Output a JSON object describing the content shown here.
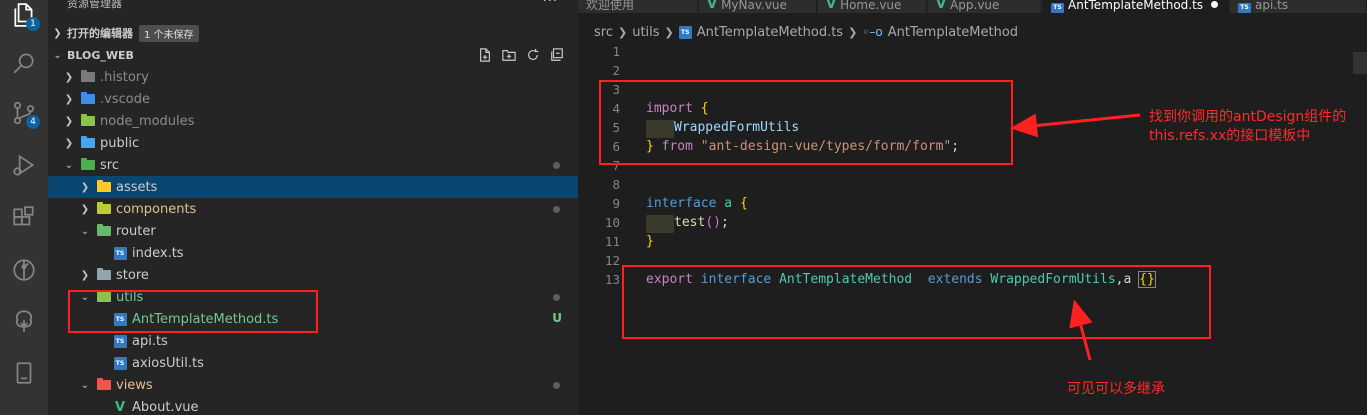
{
  "colors": {
    "accent": "#0e639c",
    "selection": "#094771",
    "annotation_red": "#ff2020"
  },
  "activity_bar": {
    "icons": [
      {
        "name": "explorer-icon",
        "badge": "1"
      },
      {
        "name": "search-icon",
        "badge": ""
      },
      {
        "name": "source-control-icon",
        "badge": "4"
      },
      {
        "name": "run-debug-icon",
        "badge": ""
      },
      {
        "name": "extensions-icon",
        "badge": ""
      },
      {
        "name": "git-graph-icon",
        "badge": ""
      },
      {
        "name": "tree-icon",
        "badge": ""
      },
      {
        "name": "device-icon",
        "badge": ""
      }
    ]
  },
  "sidebar": {
    "title": "资源管理器",
    "more": "···",
    "open_editors": {
      "label": "打开的编辑器",
      "badge": "1 个未保存"
    },
    "project": {
      "label": "BLOG_WEB"
    },
    "tree": [
      {
        "label": ".history",
        "kind": "folder",
        "color": "#7a7a7a",
        "indent": 0,
        "open": false,
        "status": ""
      },
      {
        "label": ".vscode",
        "kind": "folder",
        "color": "#3b8eea",
        "indent": 0,
        "open": false,
        "status": ""
      },
      {
        "label": "node_modules",
        "kind": "folder",
        "color": "#8bc34a",
        "indent": 0,
        "open": false,
        "status": ""
      },
      {
        "label": "public",
        "kind": "folder",
        "color": "#42a5f5",
        "indent": 0,
        "open": false,
        "status": ""
      },
      {
        "label": "src",
        "kind": "folder",
        "color": "#4caf50",
        "indent": 0,
        "open": true,
        "status": "dot"
      },
      {
        "label": "assets",
        "kind": "folder",
        "color": "#ffca28",
        "indent": 1,
        "open": false,
        "status": "",
        "selected": true
      },
      {
        "label": "components",
        "kind": "folder",
        "color": "#c0ca33",
        "indent": 1,
        "open": false,
        "status": "dot"
      },
      {
        "label": "router",
        "kind": "folder",
        "color": "#66bb6a",
        "indent": 1,
        "open": true,
        "status": ""
      },
      {
        "label": "index.ts",
        "kind": "ts",
        "indent": 2,
        "status": ""
      },
      {
        "label": "store",
        "kind": "folder",
        "color": "#90a4ae",
        "indent": 1,
        "open": false,
        "status": ""
      },
      {
        "label": "utils",
        "kind": "folder",
        "color": "#8bc34a",
        "indent": 1,
        "open": true,
        "status": "dot",
        "tone": "green"
      },
      {
        "label": "AntTemplateMethod.ts",
        "kind": "ts",
        "indent": 2,
        "status": "U",
        "tone": "green"
      },
      {
        "label": "api.ts",
        "kind": "ts",
        "indent": 2,
        "status": ""
      },
      {
        "label": "axiosUtil.ts",
        "kind": "ts",
        "indent": 2,
        "status": ""
      },
      {
        "label": "views",
        "kind": "folder",
        "color": "#ef5350",
        "indent": 1,
        "open": true,
        "status": "dot",
        "tone": "yellow"
      },
      {
        "label": "About.vue",
        "kind": "vue",
        "indent": 2,
        "status": ""
      }
    ]
  },
  "tabs": [
    {
      "label": "欢迎使用",
      "icon": "",
      "active": false
    },
    {
      "label": "MyNav.vue",
      "icon": "vue",
      "active": false
    },
    {
      "label": "Home.vue",
      "icon": "vue",
      "active": false
    },
    {
      "label": "App.vue",
      "icon": "vue",
      "active": false
    },
    {
      "label": "AntTemplateMethod.ts",
      "icon": "ts",
      "active": true,
      "dirty": true
    },
    {
      "label": "api.ts",
      "icon": "ts",
      "active": false
    }
  ],
  "breadcrumb": {
    "parts": [
      "src",
      "utils",
      "AntTemplateMethod.ts",
      "AntTemplateMethod"
    ]
  },
  "editor": {
    "line_numbers": [
      "1",
      "2",
      "3",
      "4",
      "5",
      "6",
      "7",
      "8",
      "9",
      "10",
      "11",
      "12",
      "13"
    ],
    "code": {
      "l4_import": "import",
      "l4_brace": "{",
      "l5_ident": "WrappedFormUtils",
      "l6_brace": "}",
      "l6_from": "from",
      "l6_path": "\"ant-design-vue/types/form/form\"",
      "l6_semi": ";",
      "l9_interface": "interface",
      "l9_name": "a",
      "l9_brace": "{",
      "l10_fn": "test",
      "l10_rest": "();",
      "l11_brace": "}",
      "l13_export": "export",
      "l13_interface": "interface",
      "l13_name": "AntTemplateMethod",
      "l13_extends": "extends",
      "l13_base": "WrappedFormUtils",
      "l13_comma": ",a",
      "l13_braces": "{}"
    }
  },
  "annotations": {
    "note1_line1": "找到你调用的antDesign组件的",
    "note1_line2": "this.refs.xx的接口模板中",
    "note2": "可见可以多继承"
  }
}
